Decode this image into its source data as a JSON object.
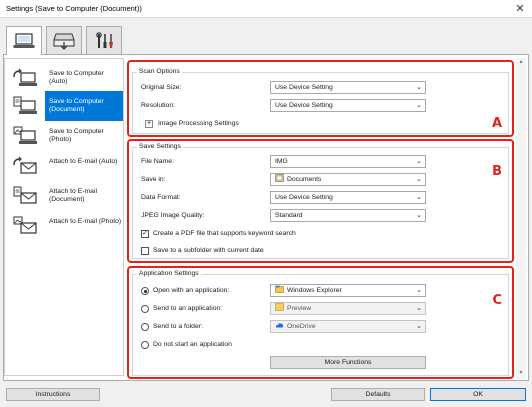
{
  "window": {
    "title": "Settings (Save to Computer (Document))",
    "close_glyph": "✕"
  },
  "tabs": [
    {
      "icon": "scan-computer-icon",
      "active": true
    },
    {
      "icon": "scan-device-icon",
      "active": false
    },
    {
      "icon": "tools-icon",
      "active": false
    }
  ],
  "sidebar": {
    "items": [
      {
        "label": "Save to Computer (Auto)",
        "icon": "computer-auto-icon",
        "selected": false
      },
      {
        "label": "Save to Computer (Document)",
        "icon": "computer-document-icon",
        "selected": true
      },
      {
        "label": "Save to Computer (Photo)",
        "icon": "computer-photo-icon",
        "selected": false
      },
      {
        "label": "Attach to E-mail (Auto)",
        "icon": "email-auto-icon",
        "selected": false
      },
      {
        "label": "Attach to E-mail (Document)",
        "icon": "email-document-icon",
        "selected": false
      },
      {
        "label": "Attach to E-mail (Photo)",
        "icon": "email-photo-icon",
        "selected": false
      }
    ]
  },
  "scan_options": {
    "legend": "Scan Options",
    "letter": "A",
    "original_size_label": "Original Size:",
    "original_size_value": "Use Device Setting",
    "resolution_label": "Resolution:",
    "resolution_value": "Use Device Setting",
    "image_processing_label": "Image Processing Settings"
  },
  "save_settings": {
    "legend": "Save Settings",
    "letter": "B",
    "file_name_label": "File Name:",
    "file_name_value": "IMG",
    "save_in_label": "Save in:",
    "save_in_value": "Documents",
    "data_format_label": "Data Format:",
    "data_format_value": "Use Device Setting",
    "jpeg_quality_label": "JPEG Image Quality:",
    "jpeg_quality_value": "Standard",
    "keyword_search_label": "Create a PDF file that supports keyword search",
    "keyword_search_checked": true,
    "subfolder_label": "Save to a subfolder with current date",
    "subfolder_checked": false
  },
  "application_settings": {
    "legend": "Application Settings",
    "letter": "C",
    "open_with_label": "Open with an application:",
    "open_with_value": "Windows Explorer",
    "send_app_label": "Send to an application:",
    "send_app_value": "Preview",
    "send_folder_label": "Send to a folder:",
    "send_folder_value": "OneDrive",
    "no_start_label": "Do not start an application",
    "selected_option": "open_with",
    "more_functions_label": "More Functions"
  },
  "footer": {
    "instructions_label": "Instructions",
    "defaults_label": "Defaults",
    "ok_label": "OK"
  },
  "colors": {
    "selection": "#0078d7",
    "highlight_border": "#e2231a"
  }
}
